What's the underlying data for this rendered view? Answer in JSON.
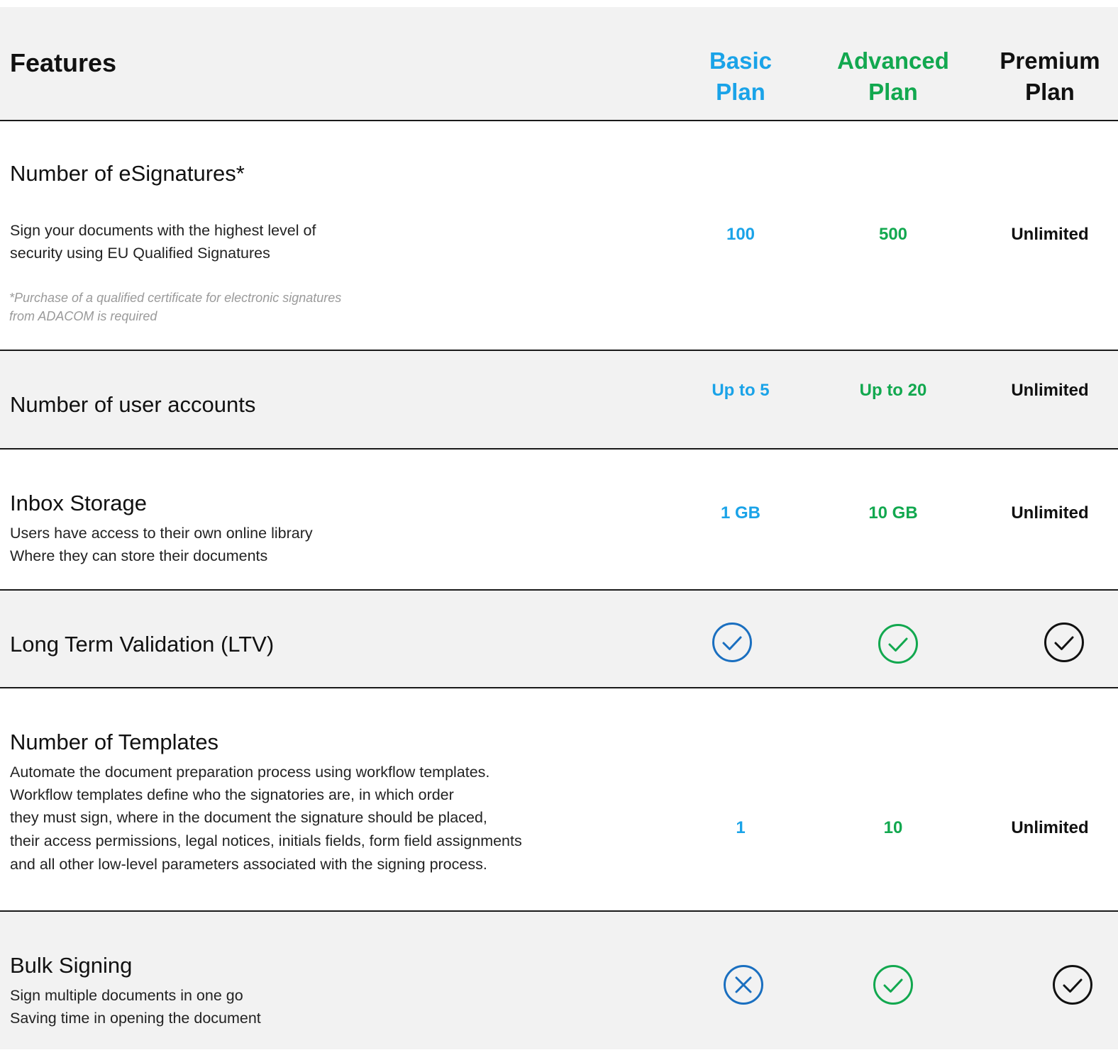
{
  "header": {
    "features_label": "Features",
    "basic": {
      "line1": "Basic",
      "line2": "Plan"
    },
    "advanced": {
      "line1": "Advanced",
      "line2": "Plan"
    },
    "premium": {
      "line1": "Premium",
      "line2": "Plan"
    }
  },
  "colors": {
    "basic": "#1aa3e8",
    "basic_icon": "#1a6fc0",
    "advanced": "#12a84f",
    "premium": "#111111",
    "row_grey": "#f2f2f2",
    "divider": "#1a1a1a"
  },
  "rows": [
    {
      "title": "Number of eSignatures*",
      "desc1": "Sign your documents with the highest level of",
      "desc2": "security using EU Qualified Signatures",
      "note1": "*Purchase of a qualified certificate for electronic signatures",
      "note2": "from ADACOM is required",
      "basic": "100",
      "advanced": "500",
      "premium": "Unlimited"
    },
    {
      "title": "Number of user accounts",
      "basic": "Up to 5",
      "advanced": "Up to 20",
      "premium": "Unlimited"
    },
    {
      "title": "Inbox Storage",
      "desc1": "Users have access to their own online library",
      "desc2": "Where they can store their documents",
      "basic": "1 GB",
      "advanced": "10 GB",
      "premium": "Unlimited"
    },
    {
      "title": "Long Term Validation (LTV)",
      "basic_icon": "check-circle-icon",
      "advanced_icon": "check-circle-icon",
      "premium_icon": "check-circle-icon"
    },
    {
      "title": "Number of Templates",
      "desc1": "Automate the document preparation process using workflow templates.",
      "desc2": "Workflow templates define who the signatories are, in which order",
      "desc3": "they must sign, where in the document the signature should be placed,",
      "desc4": "their access permissions, legal notices, initials fields, form field assignments",
      "desc5": "and all other low-level parameters associated with the signing process.",
      "basic": "1",
      "advanced": "10",
      "premium": "Unlimited"
    },
    {
      "title": "Bulk Signing",
      "desc1": "Sign multiple documents in one go",
      "desc2": "Saving time in opening the document",
      "basic_icon": "x-circle-icon",
      "advanced_icon": "check-circle-icon",
      "premium_icon": "check-circle-icon"
    }
  ]
}
